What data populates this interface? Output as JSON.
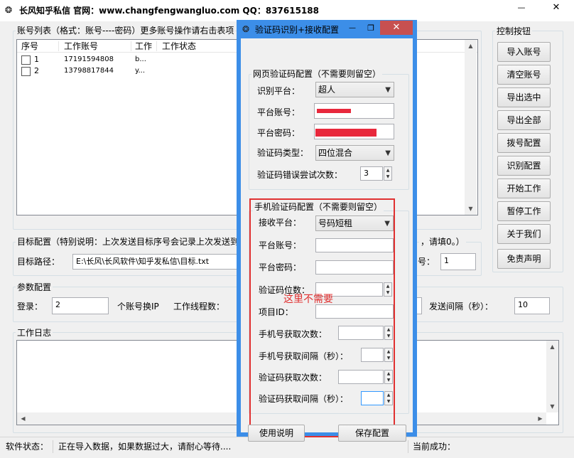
{
  "main_window": {
    "title": "长风知乎私信 官网：www.changfengwangluo.com QQ：837615188",
    "minimize": "—",
    "close": "✕"
  },
  "account_list": {
    "title": "账号列表（格式：账号----密码）更多账号操作请右击表项",
    "columns": [
      "序号",
      "工作账号",
      "工作",
      "工作状态"
    ],
    "rows": [
      {
        "no": "1",
        "account": "17191594808",
        "pwd": "b..."
      },
      {
        "no": "2",
        "account": "13798817844",
        "pwd": "y..."
      }
    ]
  },
  "controls": {
    "title": "控制按钮",
    "buttons": [
      "导入账号",
      "清空账号",
      "导出选中",
      "导出全部",
      "拨号配置",
      "识别配置",
      "开始工作",
      "暂停工作",
      "关于我们",
      "免责声明"
    ]
  },
  "target_config": {
    "title": "目标配置（特别说明：上次发送目标序号会记录上次发送到",
    "tail_text": "，请填0。）",
    "path_label": "目标路径：",
    "path_value": "E:\\长风\\长风软件\\知乎发私信\\目标.txt",
    "start_label": "号：",
    "start_value": "1"
  },
  "params": {
    "title": "参数配置",
    "login_label": "登录：",
    "login_value": "2",
    "switch_ip_label": "个账号换IP",
    "threads_label": "工作线程数：",
    "interval_label": "发送间隔（秒）：",
    "interval_value": "10"
  },
  "log": {
    "title": "工作日志"
  },
  "status_bar": {
    "label": "软件状态：",
    "message": "正在导入数据，如果数据过大，请耐心等待....",
    "success_label": "当前成功："
  },
  "dialog": {
    "title": "验证码识别+接收配置",
    "minimize": "—",
    "restore": "❐",
    "close": "✕",
    "web_captcha": {
      "title": "网页验证码配置（不需要则留空）",
      "platform_label": "识别平台：",
      "platform_value": "超人",
      "account_label": "平台账号：",
      "password_label": "平台密码：",
      "type_label": "验证码类型：",
      "type_value": "四位混合",
      "retries_label": "验证码错误尝试次数：",
      "retries_value": "3"
    },
    "phone_captcha": {
      "title": "手机验证码配置（不需要则留空）",
      "receive_label": "接收平台：",
      "receive_value": "号码短租",
      "account_label": "平台账号：",
      "password_label": "平台密码：",
      "digits_label": "验证码位数：",
      "project_label": "项目ID：",
      "phone_fetch_count_label": "手机号获取次数：",
      "phone_fetch_interval_label": "手机号获取间隔（秒）：",
      "code_fetch_count_label": "验证码获取次数：",
      "code_fetch_interval_label": "验证码获取间隔（秒）：",
      "annotation": "这里不需要"
    },
    "help_button": "使用说明",
    "save_button": "保存配置"
  },
  "colors": {
    "dialog_border": "#3c8ee8",
    "dialog_close": "#c75050",
    "annotation_red": "#e03030",
    "selection_blue": "#3399ff"
  }
}
